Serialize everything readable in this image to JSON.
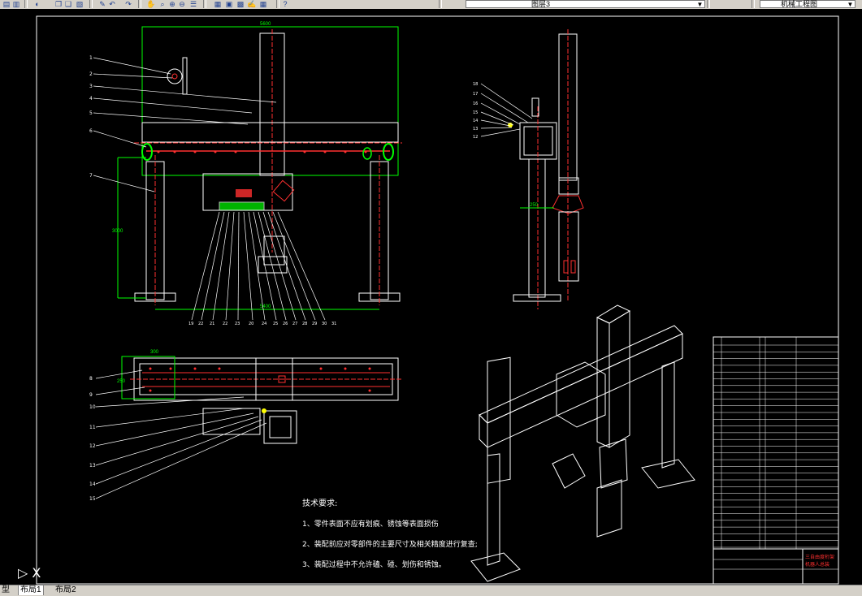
{
  "toolbar": {
    "icons": [
      "layers-icon",
      "stack-icon",
      "zoom-realtime-icon",
      "copy-icon",
      "paste-icon",
      "match-icon",
      "brush-icon",
      "undo-icon",
      "redo-icon",
      "pan-icon",
      "zoom-icon",
      "zoom-window-icon",
      "zoom-previous-icon",
      "properties-icon",
      "design-center-icon",
      "tool-palette-icon",
      "sheet-set-icon",
      "markup-icon",
      "calculator-icon",
      "help-icon"
    ],
    "layer_value": "图层3",
    "workspace_value": "机械工程图"
  },
  "drawing": {
    "front_dim_top": "5600",
    "front_dim_bottom": "5400",
    "front_dim_side": "3000",
    "side_dim": "250",
    "plan_dim": "300",
    "plan_dim_side": "250",
    "front_callouts": [
      "1",
      "2",
      "3",
      "4",
      "5",
      "6",
      "7"
    ],
    "front_bottom_callouts": [
      "19",
      "22",
      "21",
      "22",
      "23",
      "20",
      "24",
      "25",
      "26",
      "27",
      "28",
      "29",
      "30",
      "31"
    ],
    "side_callouts": [
      "18",
      "17",
      "16",
      "15",
      "14",
      "13",
      "12"
    ],
    "plan_callouts": [
      "8",
      "9",
      "10",
      "11",
      "12",
      "13",
      "14",
      "15"
    ],
    "tech_req_title": "技术要求:",
    "tech_req": [
      "1、零件表面不应有划痕、锈蚀等表面损伤",
      "2、装配前应对零部件的主要尺寸及相关精度进行复查;",
      "3、装配过程中不允许磕、碰、划伤和锈蚀。"
    ],
    "title_block": {
      "name_line1": "三自由度桁架",
      "name_line2": "机器人总装"
    }
  },
  "tabs": [
    "型",
    "布局1",
    "布局2"
  ],
  "colors": {
    "bg": "#000000",
    "line": "#ffffff",
    "dim": "#00ff00",
    "center": "#ff0000",
    "red": "#ff3030",
    "yellow": "#ffff00",
    "frame": "#ffffff"
  }
}
